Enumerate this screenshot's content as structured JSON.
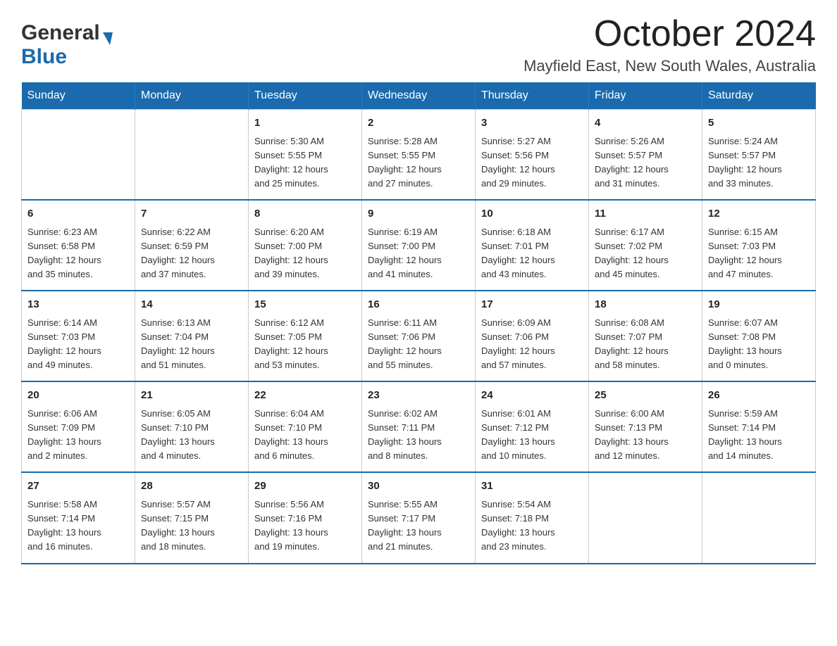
{
  "header": {
    "logo_general": "General",
    "logo_blue": "Blue",
    "month_title": "October 2024",
    "location": "Mayfield East, New South Wales, Australia"
  },
  "days_of_week": [
    "Sunday",
    "Monday",
    "Tuesday",
    "Wednesday",
    "Thursday",
    "Friday",
    "Saturday"
  ],
  "weeks": [
    [
      {
        "day": "",
        "info": ""
      },
      {
        "day": "",
        "info": ""
      },
      {
        "day": "1",
        "info": "Sunrise: 5:30 AM\nSunset: 5:55 PM\nDaylight: 12 hours\nand 25 minutes."
      },
      {
        "day": "2",
        "info": "Sunrise: 5:28 AM\nSunset: 5:55 PM\nDaylight: 12 hours\nand 27 minutes."
      },
      {
        "day": "3",
        "info": "Sunrise: 5:27 AM\nSunset: 5:56 PM\nDaylight: 12 hours\nand 29 minutes."
      },
      {
        "day": "4",
        "info": "Sunrise: 5:26 AM\nSunset: 5:57 PM\nDaylight: 12 hours\nand 31 minutes."
      },
      {
        "day": "5",
        "info": "Sunrise: 5:24 AM\nSunset: 5:57 PM\nDaylight: 12 hours\nand 33 minutes."
      }
    ],
    [
      {
        "day": "6",
        "info": "Sunrise: 6:23 AM\nSunset: 6:58 PM\nDaylight: 12 hours\nand 35 minutes."
      },
      {
        "day": "7",
        "info": "Sunrise: 6:22 AM\nSunset: 6:59 PM\nDaylight: 12 hours\nand 37 minutes."
      },
      {
        "day": "8",
        "info": "Sunrise: 6:20 AM\nSunset: 7:00 PM\nDaylight: 12 hours\nand 39 minutes."
      },
      {
        "day": "9",
        "info": "Sunrise: 6:19 AM\nSunset: 7:00 PM\nDaylight: 12 hours\nand 41 minutes."
      },
      {
        "day": "10",
        "info": "Sunrise: 6:18 AM\nSunset: 7:01 PM\nDaylight: 12 hours\nand 43 minutes."
      },
      {
        "day": "11",
        "info": "Sunrise: 6:17 AM\nSunset: 7:02 PM\nDaylight: 12 hours\nand 45 minutes."
      },
      {
        "day": "12",
        "info": "Sunrise: 6:15 AM\nSunset: 7:03 PM\nDaylight: 12 hours\nand 47 minutes."
      }
    ],
    [
      {
        "day": "13",
        "info": "Sunrise: 6:14 AM\nSunset: 7:03 PM\nDaylight: 12 hours\nand 49 minutes."
      },
      {
        "day": "14",
        "info": "Sunrise: 6:13 AM\nSunset: 7:04 PM\nDaylight: 12 hours\nand 51 minutes."
      },
      {
        "day": "15",
        "info": "Sunrise: 6:12 AM\nSunset: 7:05 PM\nDaylight: 12 hours\nand 53 minutes."
      },
      {
        "day": "16",
        "info": "Sunrise: 6:11 AM\nSunset: 7:06 PM\nDaylight: 12 hours\nand 55 minutes."
      },
      {
        "day": "17",
        "info": "Sunrise: 6:09 AM\nSunset: 7:06 PM\nDaylight: 12 hours\nand 57 minutes."
      },
      {
        "day": "18",
        "info": "Sunrise: 6:08 AM\nSunset: 7:07 PM\nDaylight: 12 hours\nand 58 minutes."
      },
      {
        "day": "19",
        "info": "Sunrise: 6:07 AM\nSunset: 7:08 PM\nDaylight: 13 hours\nand 0 minutes."
      }
    ],
    [
      {
        "day": "20",
        "info": "Sunrise: 6:06 AM\nSunset: 7:09 PM\nDaylight: 13 hours\nand 2 minutes."
      },
      {
        "day": "21",
        "info": "Sunrise: 6:05 AM\nSunset: 7:10 PM\nDaylight: 13 hours\nand 4 minutes."
      },
      {
        "day": "22",
        "info": "Sunrise: 6:04 AM\nSunset: 7:10 PM\nDaylight: 13 hours\nand 6 minutes."
      },
      {
        "day": "23",
        "info": "Sunrise: 6:02 AM\nSunset: 7:11 PM\nDaylight: 13 hours\nand 8 minutes."
      },
      {
        "day": "24",
        "info": "Sunrise: 6:01 AM\nSunset: 7:12 PM\nDaylight: 13 hours\nand 10 minutes."
      },
      {
        "day": "25",
        "info": "Sunrise: 6:00 AM\nSunset: 7:13 PM\nDaylight: 13 hours\nand 12 minutes."
      },
      {
        "day": "26",
        "info": "Sunrise: 5:59 AM\nSunset: 7:14 PM\nDaylight: 13 hours\nand 14 minutes."
      }
    ],
    [
      {
        "day": "27",
        "info": "Sunrise: 5:58 AM\nSunset: 7:14 PM\nDaylight: 13 hours\nand 16 minutes."
      },
      {
        "day": "28",
        "info": "Sunrise: 5:57 AM\nSunset: 7:15 PM\nDaylight: 13 hours\nand 18 minutes."
      },
      {
        "day": "29",
        "info": "Sunrise: 5:56 AM\nSunset: 7:16 PM\nDaylight: 13 hours\nand 19 minutes."
      },
      {
        "day": "30",
        "info": "Sunrise: 5:55 AM\nSunset: 7:17 PM\nDaylight: 13 hours\nand 21 minutes."
      },
      {
        "day": "31",
        "info": "Sunrise: 5:54 AM\nSunset: 7:18 PM\nDaylight: 13 hours\nand 23 minutes."
      },
      {
        "day": "",
        "info": ""
      },
      {
        "day": "",
        "info": ""
      }
    ]
  ]
}
